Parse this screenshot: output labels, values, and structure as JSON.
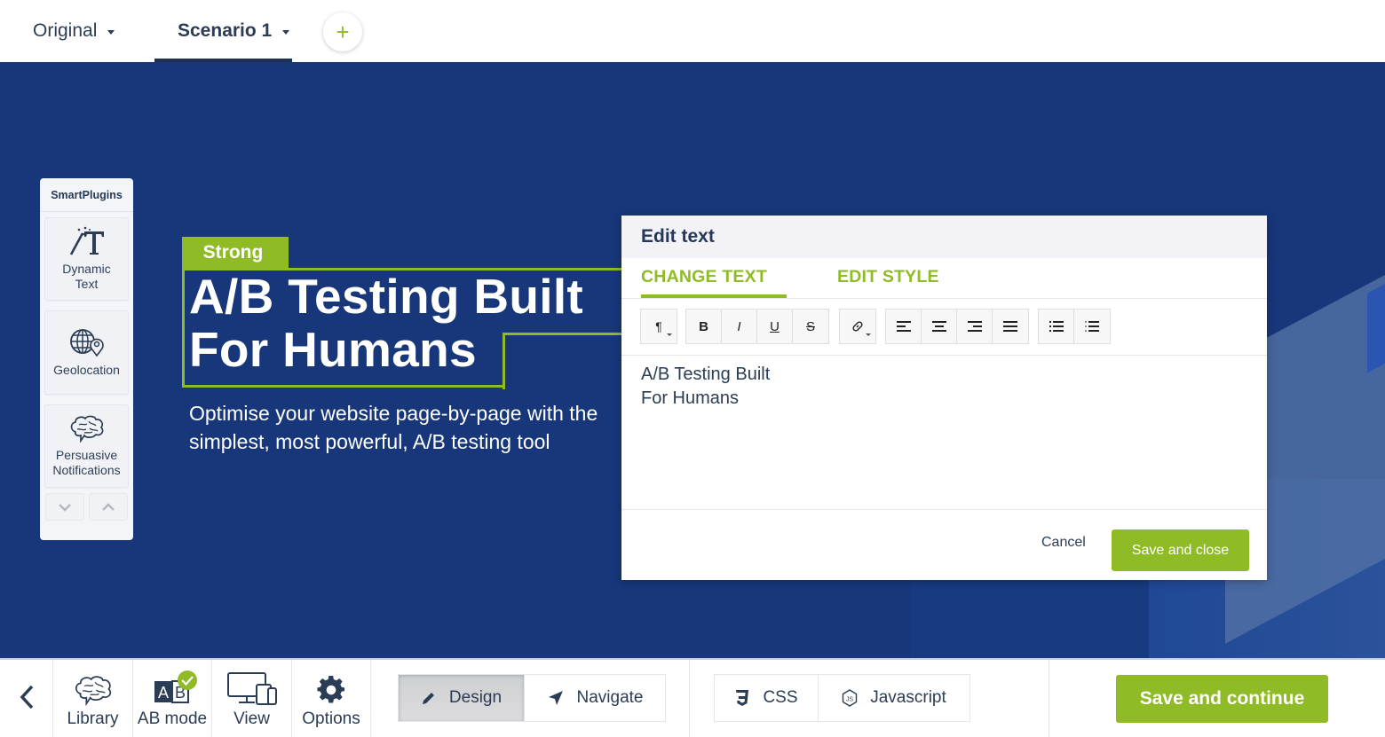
{
  "top_tabs": {
    "original": "Original",
    "scenario": "Scenario 1",
    "add_label": "+"
  },
  "smart_plugins": {
    "title": "SmartPlugins",
    "items": [
      {
        "label_line1": "Dynamic",
        "label_line2": "Text",
        "icon": "magic-text-icon"
      },
      {
        "label_line1": "Geolocation",
        "label_line2": "",
        "icon": "globe-location-icon"
      },
      {
        "label_line1": "Persuasive",
        "label_line2": "Notifications",
        "icon": "brain-icon"
      }
    ]
  },
  "hero": {
    "element_tag": "Strong",
    "headline": "A/B Testing Built\nFor Humans",
    "subline": "Optimise your website page-by-page with the\nsimplest, most powerful, A/B testing tool"
  },
  "modal": {
    "title": "Edit text",
    "tabs": [
      "CHANGE TEXT",
      "EDIT STYLE"
    ],
    "active_tab": "CHANGE TEXT",
    "toolbar": {
      "paragraph": "¶",
      "bold": "B",
      "italic": "I",
      "underline": "U",
      "strikethrough": "S"
    },
    "editor_text": "A/B Testing Built\nFor Humans",
    "cancel": "Cancel",
    "save_close": "Save and close"
  },
  "bottom_bar": {
    "library": "Library",
    "ab_mode": "AB mode",
    "ab_icon_text": "AB",
    "view": "View",
    "options": "Options",
    "design": "Design",
    "navigate": "Navigate",
    "css": "CSS",
    "javascript": "Javascript",
    "save_continue": "Save and continue"
  },
  "colors": {
    "accent_green": "#8fbb26",
    "canvas_blue": "#17377a",
    "text_dark": "#243a55"
  }
}
